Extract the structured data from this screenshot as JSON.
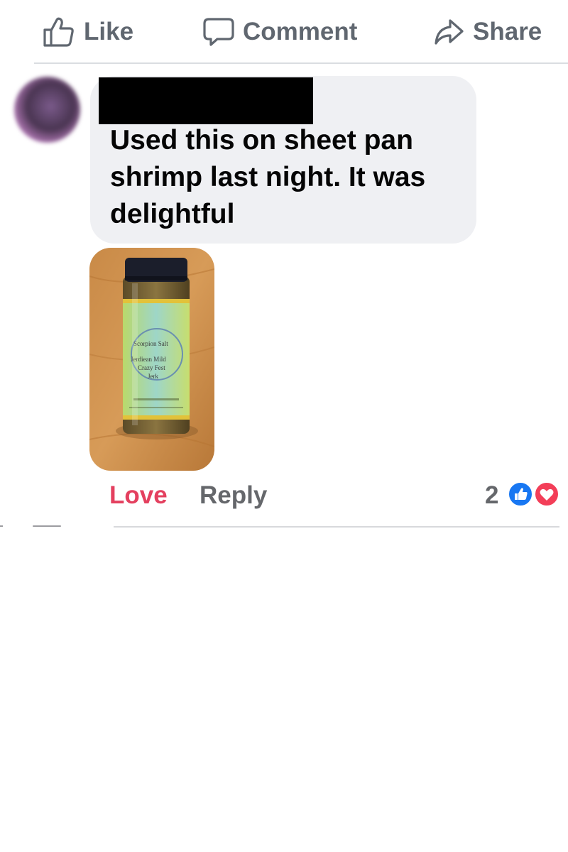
{
  "action_bar": {
    "like_label": "Like",
    "comment_label": "Comment",
    "share_label": "Share",
    "icons": {
      "like": "thumbs-up-outline-icon",
      "comment": "speech-bubble-icon",
      "share": "share-arrow-icon"
    }
  },
  "comment": {
    "author": "",
    "text": "Used this on sheet pan shrimp last night. It was delightful",
    "photo": {
      "label_brand": "Scorpion Salt",
      "label_line1": "Jerdiean Mild",
      "label_line2": "Crazy Fest",
      "label_line3": "Jerk"
    },
    "actions": {
      "love_label": "Love",
      "reply_label": "Reply"
    },
    "reactions": {
      "count": "2",
      "types": [
        "like-reaction-icon",
        "love-reaction-icon"
      ]
    }
  },
  "colors": {
    "love_active": "#e4405f",
    "action_gray": "#606770",
    "bubble_bg": "#eff0f3",
    "like_blue": "#1877f2",
    "love_red": "#f33e58"
  }
}
